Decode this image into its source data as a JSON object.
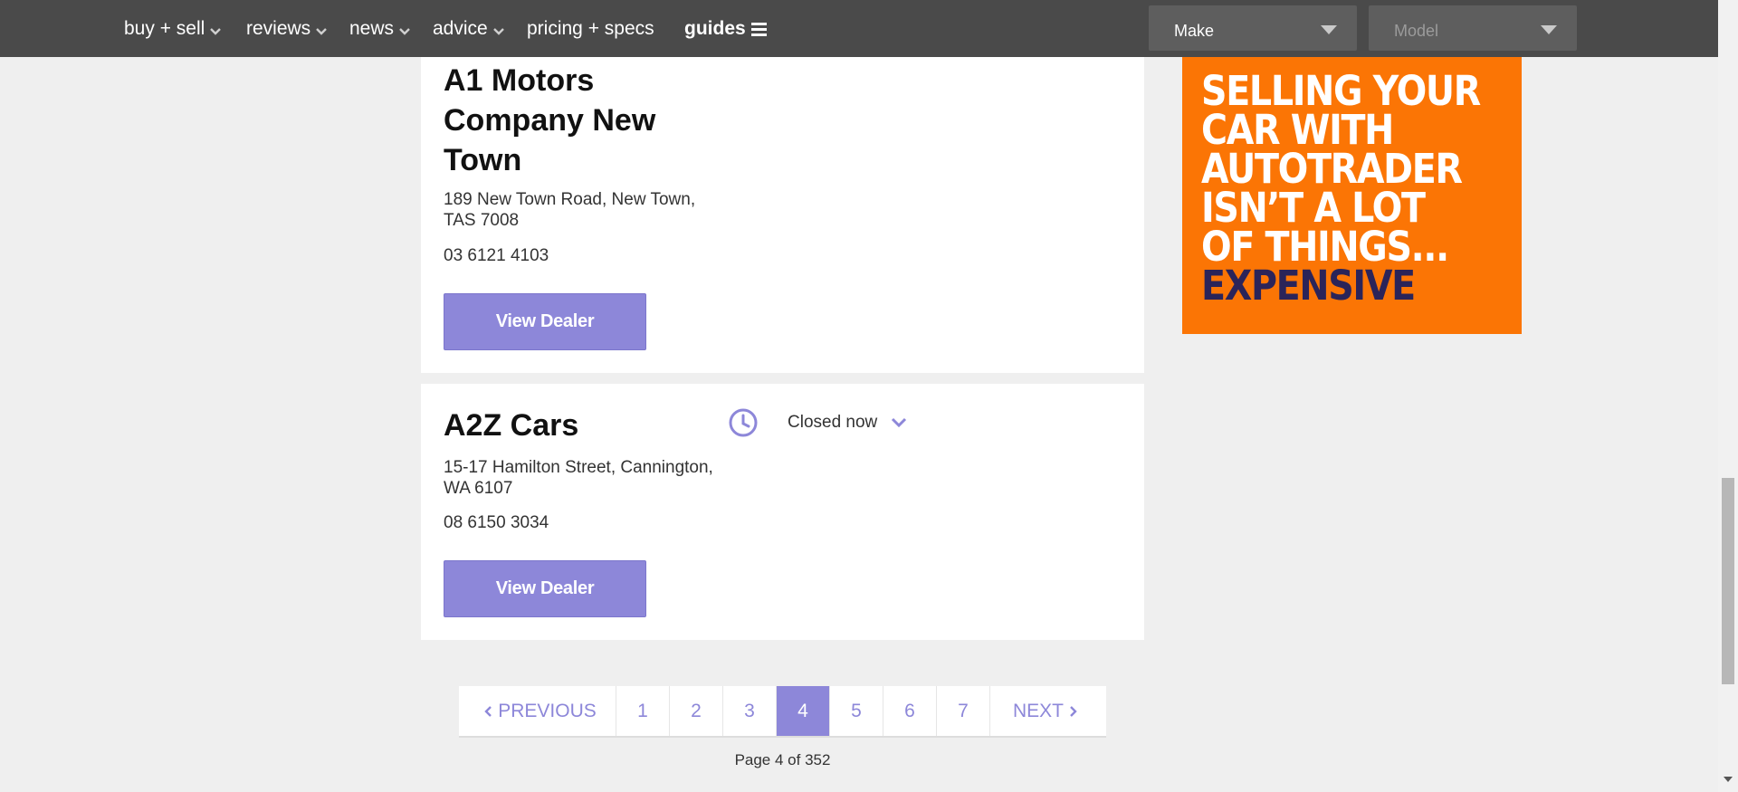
{
  "nav": {
    "items": [
      {
        "label": "buy + sell"
      },
      {
        "label": "reviews"
      },
      {
        "label": "news"
      },
      {
        "label": "advice"
      },
      {
        "label": "pricing + specs"
      },
      {
        "label": "guides"
      }
    ],
    "make_select": "Make",
    "model_select": "Model"
  },
  "dealers": [
    {
      "name_lines": [
        "A1 Motors",
        "Company New",
        "Town"
      ],
      "address_lines": [
        "189 New Town Road, New Town,",
        "TAS 7008"
      ],
      "phone": "03 6121 4103",
      "button": "View Dealer"
    },
    {
      "name_lines": [
        "A2Z Cars"
      ],
      "address_lines": [
        "15-17 Hamilton Street, Cannington,",
        "WA 6107"
      ],
      "phone": "08 6150 3034",
      "button": "View Dealer",
      "hours_status": "Closed now"
    }
  ],
  "ad": {
    "lines": [
      "SELLING YOUR",
      "CAR WITH",
      "AUTOTRADER",
      "ISN’T A LOT",
      "OF THINGS...",
      "EXPENSIVE"
    ],
    "background": "#fb7505",
    "text_color": "#ffffff",
    "highlight_color": "#2b2459"
  },
  "pagination": {
    "previous": "PREVIOUS",
    "pages": [
      "1",
      "2",
      "3",
      "4",
      "5",
      "6",
      "7"
    ],
    "current": "4",
    "next": "NEXT",
    "summary": "Page 4 of 352"
  },
  "colors": {
    "accent": "#8d87d9",
    "nav_bg": "#4a4a4a"
  }
}
